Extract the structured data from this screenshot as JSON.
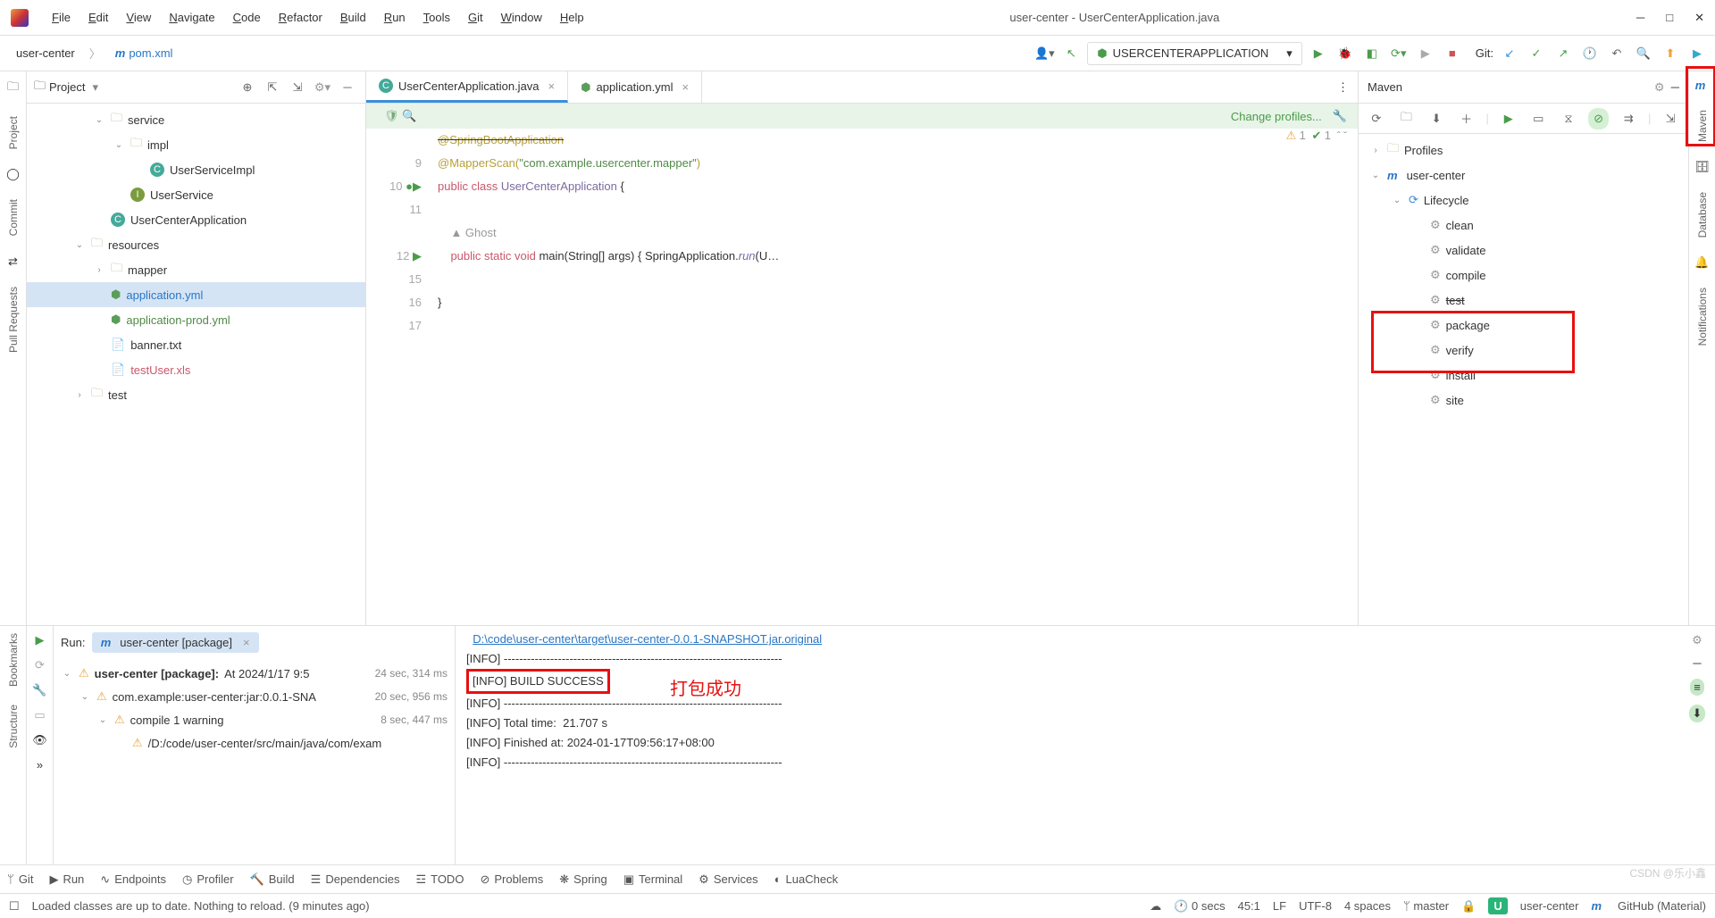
{
  "window_title": "user-center - UserCenterApplication.java",
  "menu": [
    "File",
    "Edit",
    "View",
    "Navigate",
    "Code",
    "Refactor",
    "Build",
    "Run",
    "Tools",
    "Git",
    "Window",
    "Help"
  ],
  "breadcrumb": {
    "project": "user-center",
    "file": "pom.xml"
  },
  "run_config": "USERCENTERAPPLICATION",
  "git_label": "Git:",
  "project_panel": {
    "title": "Project",
    "tree": [
      {
        "indent": 3,
        "exp": "v",
        "icon": "fld",
        "label": "service"
      },
      {
        "indent": 4,
        "exp": "v",
        "icon": "fld",
        "label": "impl"
      },
      {
        "indent": 5,
        "exp": "",
        "icon": "c",
        "label": "UserServiceImpl"
      },
      {
        "indent": 4,
        "exp": "",
        "icon": "i",
        "label": "UserService"
      },
      {
        "indent": 3,
        "exp": "",
        "icon": "c",
        "label": "UserCenterApplication"
      },
      {
        "indent": 2,
        "exp": "v",
        "icon": "fld",
        "label": "resources"
      },
      {
        "indent": 3,
        "exp": ">",
        "icon": "fld",
        "label": "mapper"
      },
      {
        "indent": 3,
        "exp": "",
        "icon": "yml",
        "label": "application.yml",
        "sel": true,
        "color": "#2976c5"
      },
      {
        "indent": 3,
        "exp": "",
        "icon": "yml",
        "label": "application-prod.yml",
        "color": "#508a46"
      },
      {
        "indent": 3,
        "exp": "",
        "icon": "txt",
        "label": "banner.txt"
      },
      {
        "indent": 3,
        "exp": "",
        "icon": "xls",
        "label": "testUser.xls",
        "color": "#c9576b"
      },
      {
        "indent": 2,
        "exp": ">",
        "icon": "fld",
        "label": "test"
      }
    ]
  },
  "tabs": [
    {
      "icon": "c",
      "label": "UserCenterApplication.java",
      "active": true
    },
    {
      "icon": "yml",
      "label": "application.yml",
      "active": false
    }
  ],
  "profile_link": "Change profiles...",
  "warnings": {
    "a": "1",
    "b": "1"
  },
  "code": {
    "lines": [
      "",
      "9",
      "10",
      "11",
      "",
      "12",
      "15",
      "16",
      "17"
    ],
    "rows": [
      {
        "html": "<span class='ann'>@SpringBootApplication</span>",
        "strike": true
      },
      {
        "html": "<span class='ann'>@MapperScan(</span><span class='str'>\"com.example.usercenter.mapper\"</span><span class='ann'>)</span>"
      },
      {
        "html": "<span class='kw'>public class</span> <span class='cls'>UserCenterApplication</span> {"
      },
      {
        "html": ""
      },
      {
        "html": "    <span style='color:#999'>▲ Ghost</span>"
      },
      {
        "html": "    <span class='kw'>public static void</span> main(String[] args) { SpringApplication.<span class='meth'>run</span>(U…"
      },
      {
        "html": ""
      },
      {
        "html": "}"
      },
      {
        "html": ""
      }
    ]
  },
  "maven": {
    "title": "Maven",
    "tree": [
      {
        "indent": 0,
        "exp": ">",
        "icon": "fld",
        "label": "Profiles"
      },
      {
        "indent": 0,
        "exp": "v",
        "icon": "m",
        "label": "user-center"
      },
      {
        "indent": 1,
        "exp": "v",
        "icon": "cy",
        "label": "Lifecycle"
      },
      {
        "indent": 2,
        "exp": "",
        "icon": "g",
        "label": "clean"
      },
      {
        "indent": 2,
        "exp": "",
        "icon": "g",
        "label": "validate"
      },
      {
        "indent": 2,
        "exp": "",
        "icon": "g",
        "label": "compile"
      },
      {
        "indent": 2,
        "exp": "",
        "icon": "g",
        "label": "test",
        "strike": true
      },
      {
        "indent": 2,
        "exp": "",
        "icon": "g",
        "label": "package"
      },
      {
        "indent": 2,
        "exp": "",
        "icon": "g",
        "label": "verify"
      },
      {
        "indent": 2,
        "exp": "",
        "icon": "g",
        "label": "install"
      },
      {
        "indent": 2,
        "exp": "",
        "icon": "g",
        "label": "site"
      }
    ]
  },
  "run": {
    "title": "Run:",
    "tab": "user-center [package]",
    "tree": [
      {
        "indent": 0,
        "exp": "v",
        "label": "user-center [package]:",
        "extra": " At 2024/1/17 9:5",
        "time": "24 sec, 314 ms",
        "bold": true
      },
      {
        "indent": 1,
        "exp": "v",
        "label": "com.example:user-center:jar:0.0.1-SNA",
        "time": "20 sec, 956 ms"
      },
      {
        "indent": 2,
        "exp": "v",
        "label": "compile  1 warning",
        "time": "8 sec, 447 ms"
      },
      {
        "indent": 3,
        "exp": "",
        "label": "/D:/code/user-center/src/main/java/com/exam"
      }
    ],
    "console": [
      {
        "type": "jar",
        "text": "D:\\code\\user-center\\target\\user-center-0.0.1-SNAPSHOT.jar.original"
      },
      {
        "type": "dash",
        "text": "[INFO] ------------------------------------------------------------------------"
      },
      {
        "type": "build",
        "text": "[INFO] BUILD SUCCESS"
      },
      {
        "type": "dash",
        "text": "[INFO] ------------------------------------------------------------------------"
      },
      {
        "type": "plain",
        "text": "[INFO] Total time:  21.707 s"
      },
      {
        "type": "plain",
        "text": "[INFO] Finished at: 2024-01-17T09:56:17+08:00"
      },
      {
        "type": "dash",
        "text": "[INFO] ------------------------------------------------------------------------"
      }
    ],
    "annotation": "打包成功"
  },
  "bottom": [
    "Git",
    "Run",
    "Endpoints",
    "Profiler",
    "Build",
    "Dependencies",
    "TODO",
    "Problems",
    "Spring",
    "Terminal",
    "Services",
    "LuaCheck"
  ],
  "status": {
    "msg": "Loaded classes are up to date. Nothing to reload. (9 minutes ago)",
    "secs": "0 secs",
    "pos": "45:1",
    "eol": "LF",
    "enc": "UTF-8",
    "indent": "4 spaces",
    "branch": "master",
    "proj": "user-center",
    "theme": "GitHub (Material)"
  },
  "watermark": "CSDN @乐小鑫"
}
